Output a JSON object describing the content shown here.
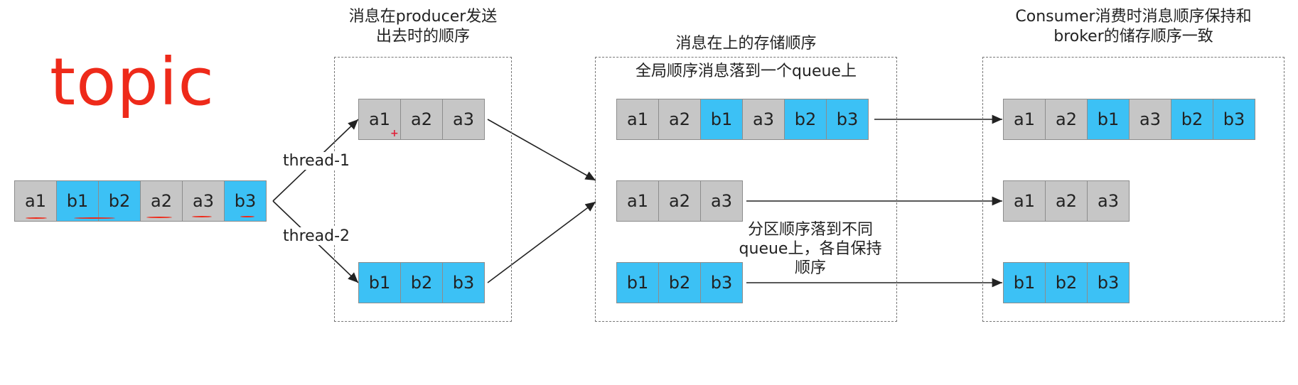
{
  "topic_label": "topic",
  "thread_labels": [
    "thread-1",
    "thread-2"
  ],
  "captions": {
    "producer": [
      "消息在producer发送",
      "出去时的顺序"
    ],
    "storage": [
      "消息在上的存储顺序"
    ],
    "global_order": "全局顺序消息落到一个queue上",
    "partition": [
      "分区顺序落到不同",
      "queue上，各自保持",
      "顺序"
    ],
    "consumer": [
      "Consumer消费时消息顺序保持和",
      "broker的储存顺序一致"
    ]
  },
  "colors": {
    "gray": "#c6c6c6",
    "blue": "#3cc1f5",
    "topic_red": "#ee2a1a"
  },
  "rows": {
    "topic_row": [
      {
        "label": "a1",
        "color": "gray"
      },
      {
        "label": "b1",
        "color": "blue"
      },
      {
        "label": "b2",
        "color": "blue"
      },
      {
        "label": "a2",
        "color": "gray"
      },
      {
        "label": "a3",
        "color": "gray"
      },
      {
        "label": "b3",
        "color": "blue"
      }
    ],
    "producer_a": [
      {
        "label": "a1",
        "color": "gray"
      },
      {
        "label": "a2",
        "color": "gray"
      },
      {
        "label": "a3",
        "color": "gray"
      }
    ],
    "producer_b": [
      {
        "label": "b1",
        "color": "blue"
      },
      {
        "label": "b2",
        "color": "blue"
      },
      {
        "label": "b3",
        "color": "blue"
      }
    ],
    "broker_global": [
      {
        "label": "a1",
        "color": "gray"
      },
      {
        "label": "a2",
        "color": "gray"
      },
      {
        "label": "b1",
        "color": "blue"
      },
      {
        "label": "a3",
        "color": "gray"
      },
      {
        "label": "b2",
        "color": "blue"
      },
      {
        "label": "b3",
        "color": "blue"
      }
    ],
    "broker_a": [
      {
        "label": "a1",
        "color": "gray"
      },
      {
        "label": "a2",
        "color": "gray"
      },
      {
        "label": "a3",
        "color": "gray"
      }
    ],
    "broker_b": [
      {
        "label": "b1",
        "color": "blue"
      },
      {
        "label": "b2",
        "color": "blue"
      },
      {
        "label": "b3",
        "color": "blue"
      }
    ],
    "consumer_global": [
      {
        "label": "a1",
        "color": "gray"
      },
      {
        "label": "a2",
        "color": "gray"
      },
      {
        "label": "b1",
        "color": "blue"
      },
      {
        "label": "a3",
        "color": "gray"
      },
      {
        "label": "b2",
        "color": "blue"
      },
      {
        "label": "b3",
        "color": "blue"
      }
    ],
    "consumer_a": [
      {
        "label": "a1",
        "color": "gray"
      },
      {
        "label": "a2",
        "color": "gray"
      },
      {
        "label": "a3",
        "color": "gray"
      }
    ],
    "consumer_b": [
      {
        "label": "b1",
        "color": "blue"
      },
      {
        "label": "b2",
        "color": "blue"
      },
      {
        "label": "b3",
        "color": "blue"
      }
    ]
  }
}
